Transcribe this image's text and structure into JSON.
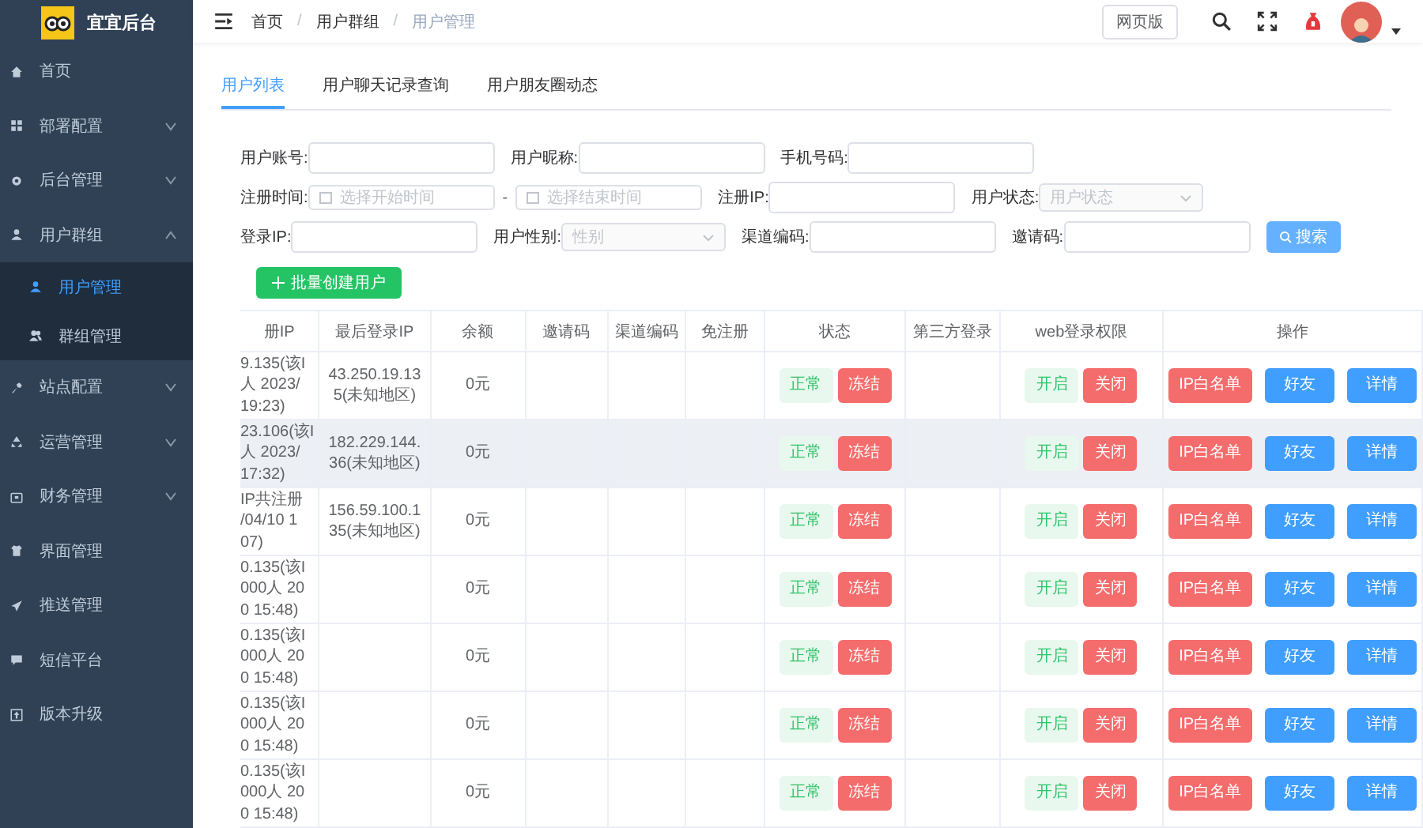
{
  "sidebar": {
    "title": "宜宜后台",
    "items": [
      {
        "label": "首页",
        "kind": "link"
      },
      {
        "label": "部署配置",
        "kind": "group",
        "expanded": false
      },
      {
        "label": "后台管理",
        "kind": "group",
        "expanded": false
      },
      {
        "label": "用户群组",
        "kind": "group",
        "expanded": true,
        "children": [
          {
            "label": "用户管理",
            "selected": true
          },
          {
            "label": "群组管理",
            "selected": false
          }
        ]
      },
      {
        "label": "站点配置",
        "kind": "group",
        "expanded": false
      },
      {
        "label": "运营管理",
        "kind": "group",
        "expanded": false
      },
      {
        "label": "财务管理",
        "kind": "group",
        "expanded": false
      },
      {
        "label": "界面管理",
        "kind": "link"
      },
      {
        "label": "推送管理",
        "kind": "link"
      },
      {
        "label": "短信平台",
        "kind": "link"
      },
      {
        "label": "版本升级",
        "kind": "link"
      }
    ]
  },
  "breadcrumb": [
    {
      "label": "首页",
      "current": false
    },
    {
      "separator": "/",
      "label": "用户群组",
      "current": false
    },
    {
      "separator": "/",
      "label": "用户管理",
      "current": true
    }
  ],
  "header": {
    "web_button": "网页版"
  },
  "tabs": [
    {
      "label": "用户列表",
      "selected": true
    },
    {
      "label": "用户聊天记录查询",
      "selected": false
    },
    {
      "label": "用户朋友圈动态",
      "selected": false
    }
  ],
  "filters": [
    [
      {
        "kind": "text",
        "label": "用户账号:"
      },
      {
        "kind": "text",
        "label": "用户昵称:"
      },
      {
        "kind": "text",
        "label": "手机号码:"
      }
    ],
    [
      {
        "kind": "daterange",
        "label": "注册时间:",
        "placeholder": "选择开始时间",
        "separator": "-",
        "placeholder_end": "选择结束时间"
      },
      {
        "kind": "text",
        "label": "注册IP:"
      },
      {
        "kind": "select",
        "label": "用户状态:",
        "placeholder": "用户状态"
      }
    ],
    [
      {
        "kind": "text",
        "label": "登录IP:"
      },
      {
        "kind": "select",
        "label": "用户性别:",
        "placeholder": "性别"
      },
      {
        "kind": "text",
        "label": "渠道编码:"
      },
      {
        "kind": "text",
        "label": "邀请码:"
      },
      {
        "kind": "button",
        "label": "搜索"
      }
    ]
  ],
  "create_button": "批量创建用户",
  "table": {
    "columns": [
      "册IP",
      "最后登录IP",
      "余额",
      "邀请码",
      "渠道编码",
      "免注册",
      "状态",
      "第三方登录",
      "web登录权限",
      "操作"
    ],
    "rows": [
      {
        "highlighted": false,
        "register_ip": "9.135(该I\n人 2023/\n19:23)",
        "last_login_ip": "43.250.19.135(未知地区)",
        "balance": "0元",
        "status": [
          "正常",
          "冻结"
        ],
        "web_login": [
          "开启",
          "关闭"
        ],
        "actions": [
          "IP白名单",
          "好友",
          "详情"
        ]
      },
      {
        "highlighted": true,
        "register_ip": "23.106(该I\n人 2023/\n17:32)",
        "last_login_ip": "182.229.144.36(未知地区)",
        "balance": "0元",
        "status": [
          "正常",
          "冻结"
        ],
        "web_login": [
          "开启",
          "关闭"
        ],
        "actions": [
          "IP白名单",
          "好友",
          "详情"
        ]
      },
      {
        "highlighted": false,
        "register_ip": "IP共注册\n/04/10 1\n07)",
        "last_login_ip": "156.59.100.135(未知地区)",
        "balance": "0元",
        "status": [
          "正常",
          "冻结"
        ],
        "web_login": [
          "开启",
          "关闭"
        ],
        "actions": [
          "IP白名单",
          "好友",
          "详情"
        ]
      },
      {
        "highlighted": false,
        "register_ip": "0.135(该I\n000人 20\n0 15:48)",
        "balance": "0元",
        "status": [
          "正常",
          "冻结"
        ],
        "web_login": [
          "开启",
          "关闭"
        ],
        "actions": [
          "IP白名单",
          "好友",
          "详情"
        ]
      },
      {
        "highlighted": false,
        "register_ip": "0.135(该I\n000人 20\n0 15:48)",
        "balance": "0元",
        "status": [
          "正常",
          "冻结"
        ],
        "web_login": [
          "开启",
          "关闭"
        ],
        "actions": [
          "IP白名单",
          "好友",
          "详情"
        ]
      },
      {
        "highlighted": false,
        "register_ip": "0.135(该I\n000人 20\n0 15:48)",
        "balance": "0元",
        "status": [
          "正常",
          "冻结"
        ],
        "web_login": [
          "开启",
          "关闭"
        ],
        "actions": [
          "IP白名单",
          "好友",
          "详情"
        ]
      },
      {
        "highlighted": false,
        "register_ip": "0.135(该I\n000人 20\n0 15:48)",
        "balance": "0元",
        "status": [
          "正常",
          "冻结"
        ],
        "web_login": [
          "开启",
          "关闭"
        ],
        "actions": [
          "IP白名单",
          "好友",
          "详情"
        ]
      }
    ]
  }
}
